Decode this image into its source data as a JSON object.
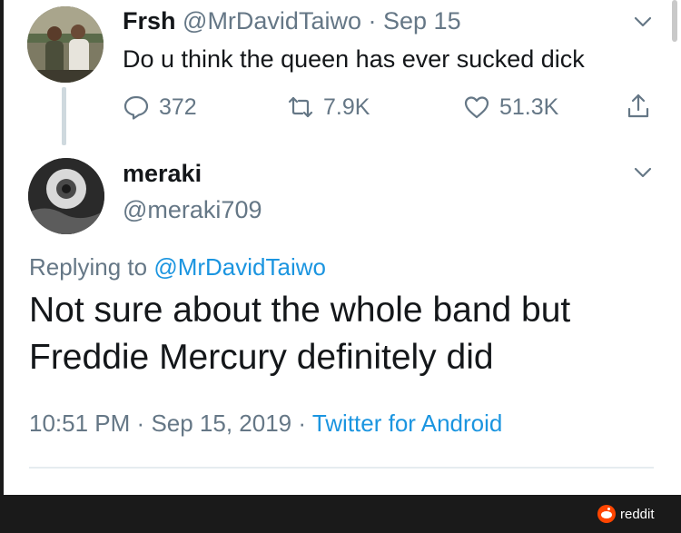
{
  "tweet1": {
    "name": "Frsh",
    "handle": "@MrDavidTaiwo",
    "separator": "·",
    "date": "Sep 15",
    "text": "Do u think the queen has ever sucked dick",
    "reply_count": "372",
    "retweet_count": "7.9K",
    "like_count": "51.3K"
  },
  "tweet2": {
    "name": "meraki",
    "handle": "@meraki709",
    "replying_prefix": "Replying to",
    "replying_to": "@MrDavidTaiwo",
    "text": "Not sure about the whole band but Freddie Mercury definitely did",
    "time": "10:51 PM",
    "separator": "·",
    "date": "Sep 15, 2019",
    "source": "Twitter for Android"
  },
  "watermark": {
    "label": "reddit"
  },
  "colors": {
    "text": "#14171a",
    "secondary": "#657786",
    "link": "#1b95e0",
    "reddit": "#ff4500"
  },
  "icons": [
    "reply-icon",
    "retweet-icon",
    "like-icon",
    "share-icon",
    "chevron-down-icon",
    "reddit-logo-icon"
  ]
}
